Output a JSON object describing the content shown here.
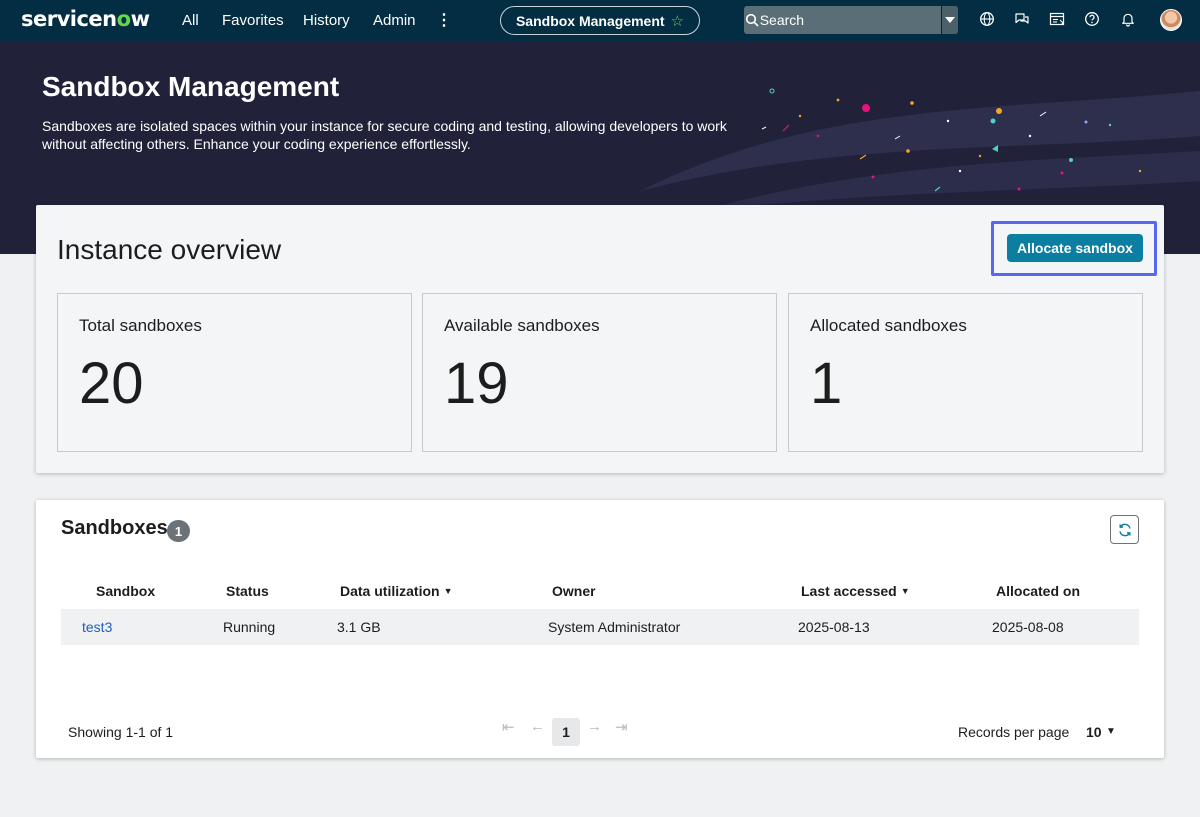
{
  "nav": {
    "logo_text_a": "servicen",
    "logo_text_o": "o",
    "logo_text_b": "w",
    "all": "All",
    "favorites": "Favorites",
    "history": "History",
    "admin": "Admin",
    "more": "⋮",
    "app_chip": "Sandbox Management",
    "search_placeholder": "Search",
    "icons": [
      "globe-icon",
      "chat-icon",
      "scripts-icon",
      "help-icon",
      "bell-icon"
    ]
  },
  "hero": {
    "title": "Sandbox Management",
    "description": "Sandboxes are isolated spaces within your instance for secure coding and testing, allowing developers to work without affecting others. Enhance your coding experience effortlessly."
  },
  "overview": {
    "title": "Instance overview",
    "allocate_label": "Allocate sandbox",
    "stats": [
      {
        "label": "Total sandboxes",
        "value": "20"
      },
      {
        "label": "Available sandboxes",
        "value": "19"
      },
      {
        "label": "Allocated sandboxes",
        "value": "1"
      }
    ]
  },
  "sandboxes": {
    "title": "Sandboxes",
    "count": "1",
    "columns": [
      "Sandbox",
      "Status",
      "Data utilization",
      "Owner",
      "Last accessed",
      "Allocated on"
    ],
    "rows": [
      {
        "sandbox": "test3",
        "status": "Running",
        "data_utilization": "3.1 GB",
        "owner": "System Administrator",
        "last_accessed": "2025-08-13",
        "allocated_on": "2025-08-08"
      }
    ],
    "showing": "Showing 1-1 of 1",
    "current_page": "1",
    "records_per_page_label": "Records per page",
    "records_per_page": "10"
  },
  "colors": {
    "nav_bg": "#032d42",
    "hero_bg": "#212239",
    "accent": "#0b7ea1",
    "focus_ring": "#5667f0",
    "link": "#1f5ebc"
  }
}
